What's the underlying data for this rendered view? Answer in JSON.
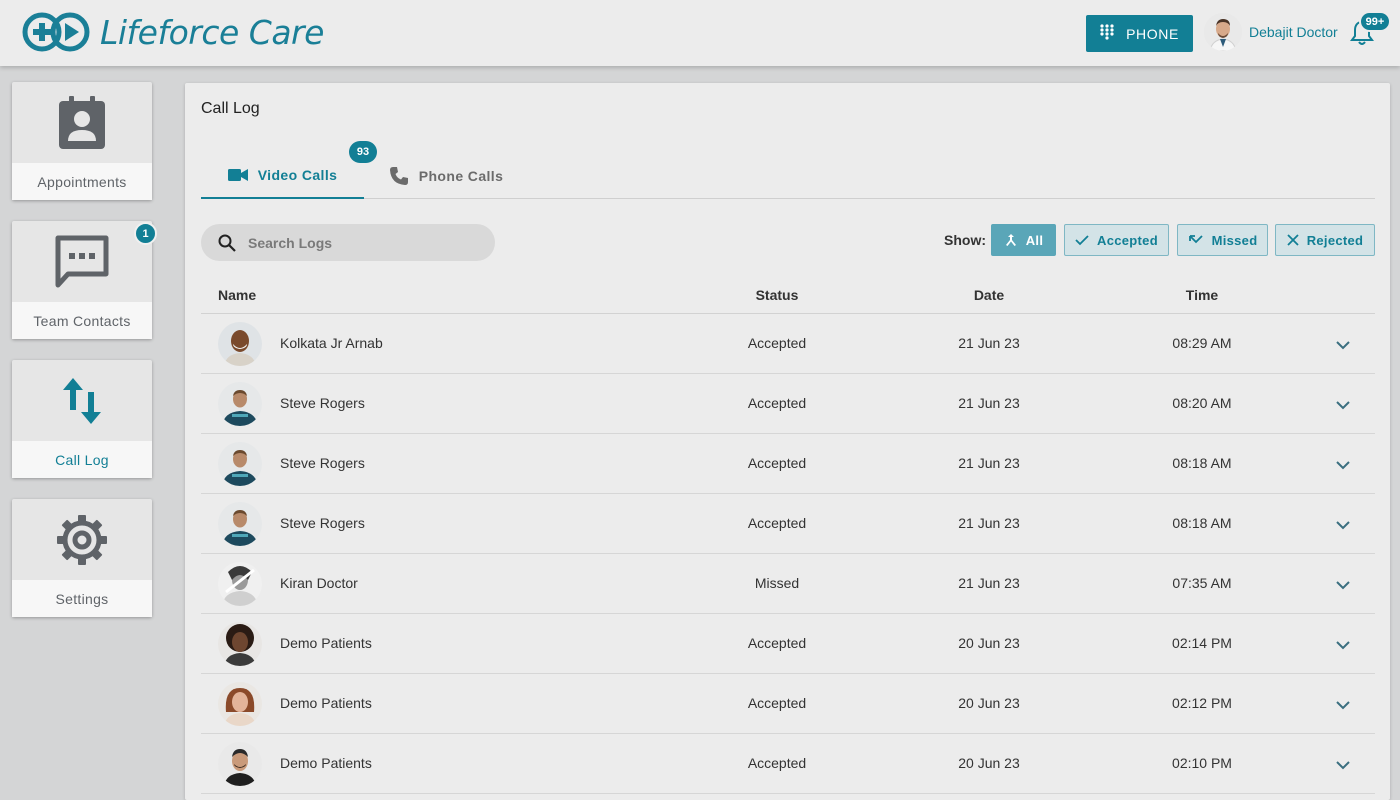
{
  "app": {
    "name": "Lifeforce Care",
    "brand_color": "#127f95"
  },
  "header": {
    "phone_button_label": "PHONE",
    "user_name": "Debajit Doctor",
    "notification_count": "99+"
  },
  "sidebar": {
    "items": [
      {
        "label": "Appointments",
        "icon": "contact-card-icon",
        "active": false
      },
      {
        "label": "Team Contacts",
        "icon": "chat-bubble-icon",
        "active": false,
        "badge": "1"
      },
      {
        "label": "Call Log",
        "icon": "swap-vertical-arrows-icon",
        "active": true
      },
      {
        "label": "Settings",
        "icon": "gear-icon",
        "active": false
      }
    ]
  },
  "main": {
    "title": "Call Log",
    "tabs": [
      {
        "label": "Video Calls",
        "icon": "videocam-icon",
        "active": true,
        "badge": "93"
      },
      {
        "label": "Phone Calls",
        "icon": "phone-handset-icon",
        "active": false
      }
    ],
    "search": {
      "placeholder": "Search Logs",
      "value": ""
    },
    "filters": {
      "label": "Show:",
      "options": [
        {
          "label": "All",
          "icon": "merge-icon",
          "active": true
        },
        {
          "label": "Accepted",
          "icon": "check-icon",
          "active": false
        },
        {
          "label": "Missed",
          "icon": "missed-call-icon",
          "active": false
        },
        {
          "label": "Rejected",
          "icon": "close-icon",
          "active": false
        }
      ]
    },
    "table": {
      "columns": [
        "Name",
        "Status",
        "Date",
        "Time"
      ],
      "rows": [
        {
          "name": "Kolkata Jr Arnab",
          "status": "Accepted",
          "date": "21 Jun 23",
          "time": "08:29 AM"
        },
        {
          "name": "Steve Rogers",
          "status": "Accepted",
          "date": "21 Jun 23",
          "time": "08:20 AM"
        },
        {
          "name": "Steve Rogers",
          "status": "Accepted",
          "date": "21 Jun 23",
          "time": "08:18 AM"
        },
        {
          "name": "Steve Rogers",
          "status": "Accepted",
          "date": "21 Jun 23",
          "time": "08:18 AM"
        },
        {
          "name": "Kiran Doctor",
          "status": "Missed",
          "date": "21 Jun 23",
          "time": "07:35 AM"
        },
        {
          "name": "Demo Patients",
          "status": "Accepted",
          "date": "20 Jun 23",
          "time": "02:14 PM"
        },
        {
          "name": "Demo Patients",
          "status": "Accepted",
          "date": "20 Jun 23",
          "time": "02:12 PM"
        },
        {
          "name": "Demo Patients",
          "status": "Accepted",
          "date": "20 Jun 23",
          "time": "02:10 PM"
        }
      ]
    }
  }
}
